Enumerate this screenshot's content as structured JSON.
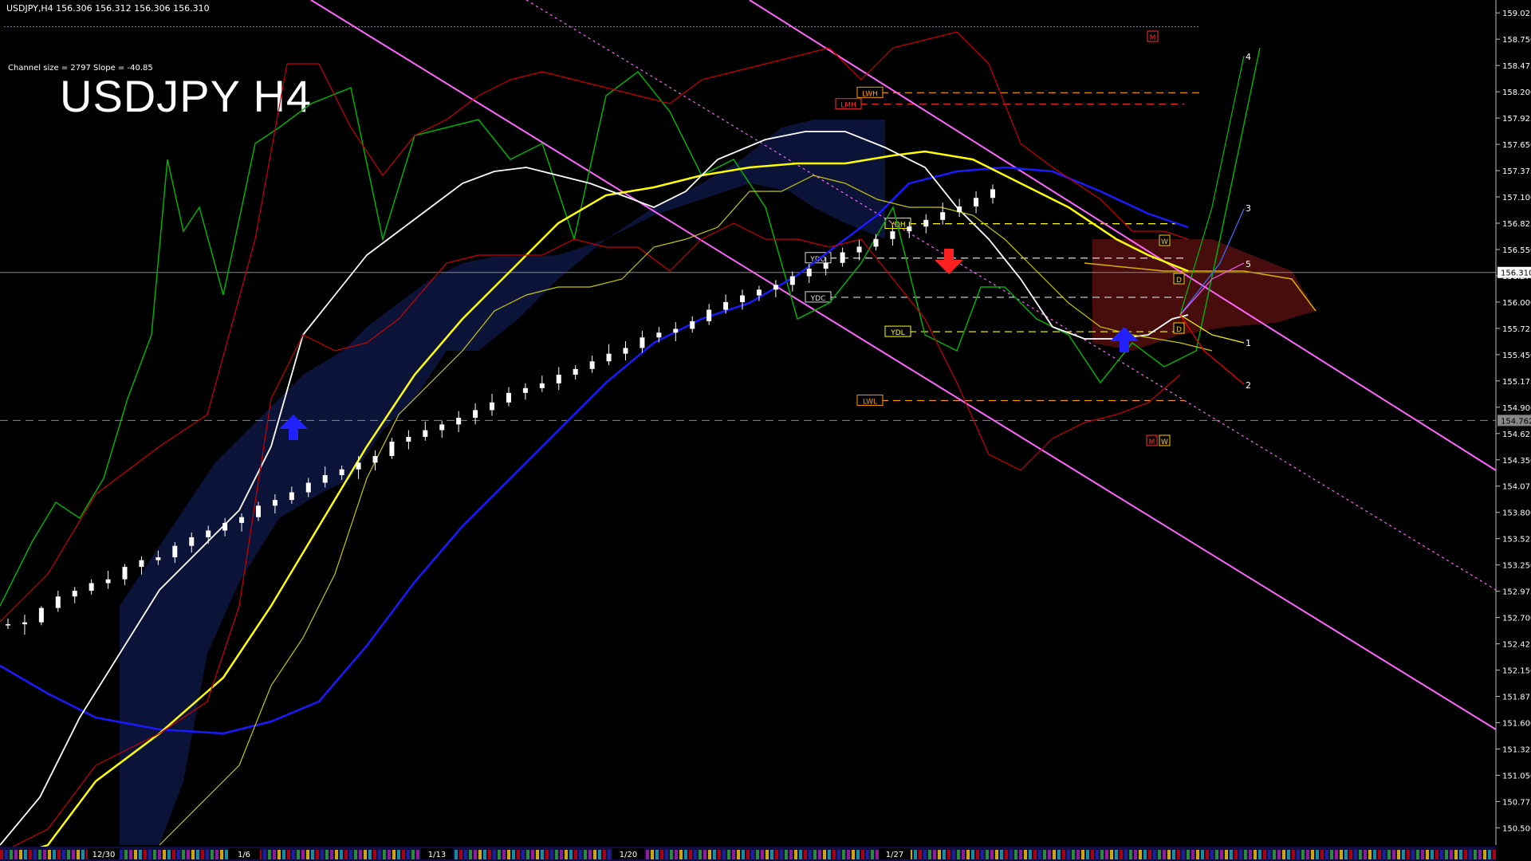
{
  "header": {
    "symbol": "USDJPY,H4",
    "ohlc": "156.306 156.312 156.306 156.310"
  },
  "channel_info": "Channel size = 2797 Slope = -40.85",
  "title": "USDJPY H4",
  "colors": {
    "background": "#000000",
    "bull": "#ffffff",
    "bear": "#ff0000",
    "ema_white": "#ffffff",
    "ema_yellow": "#ffff00",
    "ema_blue": "#1a1aff",
    "bollinger": "#cc0000",
    "chikou": "#00b000",
    "cloud_blue": "#3355ff",
    "cloud_red": "#ff3030",
    "channel": "#ff66ff",
    "arrow": "#2222ff"
  },
  "chart_data": {
    "type": "candlestick",
    "symbol": "USDJPY",
    "timeframe": "H4",
    "ylim": [
      150.32,
      159.16
    ],
    "y_ticks": [
      "159.025",
      "158.750",
      "158.475",
      "158.200",
      "157.925",
      "157.650",
      "157.375",
      "157.100",
      "156.825",
      "156.550",
      "156.275",
      "156.000",
      "155.725",
      "155.450",
      "155.175",
      "154.900",
      "154.625",
      "154.350",
      "154.075",
      "153.800",
      "153.525",
      "153.250",
      "152.975",
      "152.700",
      "152.425",
      "152.150",
      "151.875",
      "151.600",
      "151.325",
      "151.050",
      "150.775",
      "150.500"
    ],
    "x_tick_labels": [
      "12/30",
      "1/6",
      "1/13",
      "1/20",
      "1/27"
    ],
    "current_price": "156.310",
    "marked_price": "154.762",
    "levels": [
      {
        "label": "LWH",
        "price": 158.19
      },
      {
        "label": "LMH",
        "price": 158.07
      },
      {
        "label": "YDH",
        "price": 156.82
      },
      {
        "label": "YDO",
        "price": 156.46
      },
      {
        "label": "YDC",
        "price": 156.05
      },
      {
        "label": "YDL",
        "price": 155.69
      },
      {
        "label": "LWL",
        "price": 154.97
      }
    ],
    "markers": [
      "M",
      "W",
      "D",
      "D",
      "M",
      "W"
    ],
    "projection_labels": [
      "4",
      "3",
      "5",
      "1",
      "2"
    ],
    "channel": {
      "size": 2797,
      "slope": -40.85
    },
    "candles": [
      [
        152.62,
        152.69,
        152.58,
        152.63
      ],
      [
        152.63,
        152.73,
        152.52,
        152.65
      ],
      [
        152.65,
        152.82,
        152.62,
        152.8
      ],
      [
        152.8,
        152.98,
        152.76,
        152.92
      ],
      [
        152.92,
        153.02,
        152.85,
        152.98
      ],
      [
        152.98,
        153.1,
        152.94,
        153.06
      ],
      [
        153.06,
        153.19,
        153.0,
        153.1
      ],
      [
        153.1,
        153.26,
        153.04,
        153.23
      ],
      [
        153.23,
        153.34,
        153.15,
        153.3
      ],
      [
        153.3,
        153.4,
        153.25,
        153.33
      ],
      [
        153.33,
        153.49,
        153.27,
        153.45
      ],
      [
        153.45,
        153.59,
        153.38,
        153.54
      ],
      [
        153.54,
        153.66,
        153.47,
        153.61
      ],
      [
        153.61,
        153.74,
        153.55,
        153.69
      ],
      [
        153.69,
        153.79,
        153.6,
        153.75
      ],
      [
        153.75,
        153.91,
        153.71,
        153.87
      ],
      [
        153.87,
        153.99,
        153.79,
        153.93
      ],
      [
        153.93,
        154.07,
        153.89,
        154.01
      ],
      [
        154.01,
        154.16,
        153.96,
        154.11
      ],
      [
        154.11,
        154.28,
        154.06,
        154.19
      ],
      [
        154.19,
        154.29,
        154.14,
        154.25
      ],
      [
        154.25,
        154.39,
        154.15,
        154.32
      ],
      [
        154.32,
        154.45,
        154.24,
        154.39
      ],
      [
        154.39,
        154.58,
        154.36,
        154.54
      ],
      [
        154.54,
        154.66,
        154.46,
        154.59
      ],
      [
        154.59,
        154.75,
        154.55,
        154.66
      ],
      [
        154.66,
        154.76,
        154.58,
        154.72
      ],
      [
        154.72,
        154.86,
        154.64,
        154.79
      ],
      [
        154.79,
        154.94,
        154.72,
        154.87
      ],
      [
        154.87,
        155.04,
        154.81,
        154.95
      ],
      [
        154.95,
        155.11,
        154.91,
        155.05
      ],
      [
        155.05,
        155.15,
        154.98,
        155.1
      ],
      [
        155.1,
        155.23,
        155.06,
        155.15
      ],
      [
        155.15,
        155.32,
        155.08,
        155.24
      ],
      [
        155.24,
        155.34,
        155.19,
        155.3
      ],
      [
        155.3,
        155.44,
        155.26,
        155.38
      ],
      [
        155.38,
        155.56,
        155.34,
        155.46
      ],
      [
        155.46,
        155.59,
        155.39,
        155.52
      ],
      [
        155.52,
        155.7,
        155.47,
        155.63
      ],
      [
        155.63,
        155.74,
        155.58,
        155.68
      ],
      [
        155.68,
        155.79,
        155.59,
        155.72
      ],
      [
        155.72,
        155.85,
        155.68,
        155.8
      ],
      [
        155.8,
        155.98,
        155.76,
        155.92
      ],
      [
        155.92,
        156.08,
        155.88,
        156.0
      ],
      [
        156.0,
        156.13,
        155.92,
        156.07
      ],
      [
        156.07,
        156.17,
        156.01,
        156.13
      ],
      [
        156.13,
        156.23,
        156.05,
        156.18
      ],
      [
        156.18,
        156.32,
        156.11,
        156.27
      ],
      [
        156.27,
        156.4,
        156.2,
        156.35
      ],
      [
        156.35,
        156.47,
        156.28,
        156.41
      ],
      [
        156.41,
        156.57,
        156.37,
        156.52
      ],
      [
        156.52,
        156.65,
        156.44,
        156.58
      ],
      [
        156.58,
        156.71,
        156.54,
        156.66
      ],
      [
        156.66,
        156.8,
        156.59,
        156.74
      ],
      [
        156.74,
        156.84,
        156.67,
        156.79
      ],
      [
        156.79,
        156.92,
        156.72,
        156.86
      ],
      [
        156.86,
        157.04,
        156.81,
        156.94
      ],
      [
        156.94,
        157.08,
        156.89,
        157.0
      ],
      [
        157.0,
        157.16,
        156.93,
        157.09
      ],
      [
        157.09,
        157.23,
        157.03,
        157.18
      ]
    ]
  }
}
